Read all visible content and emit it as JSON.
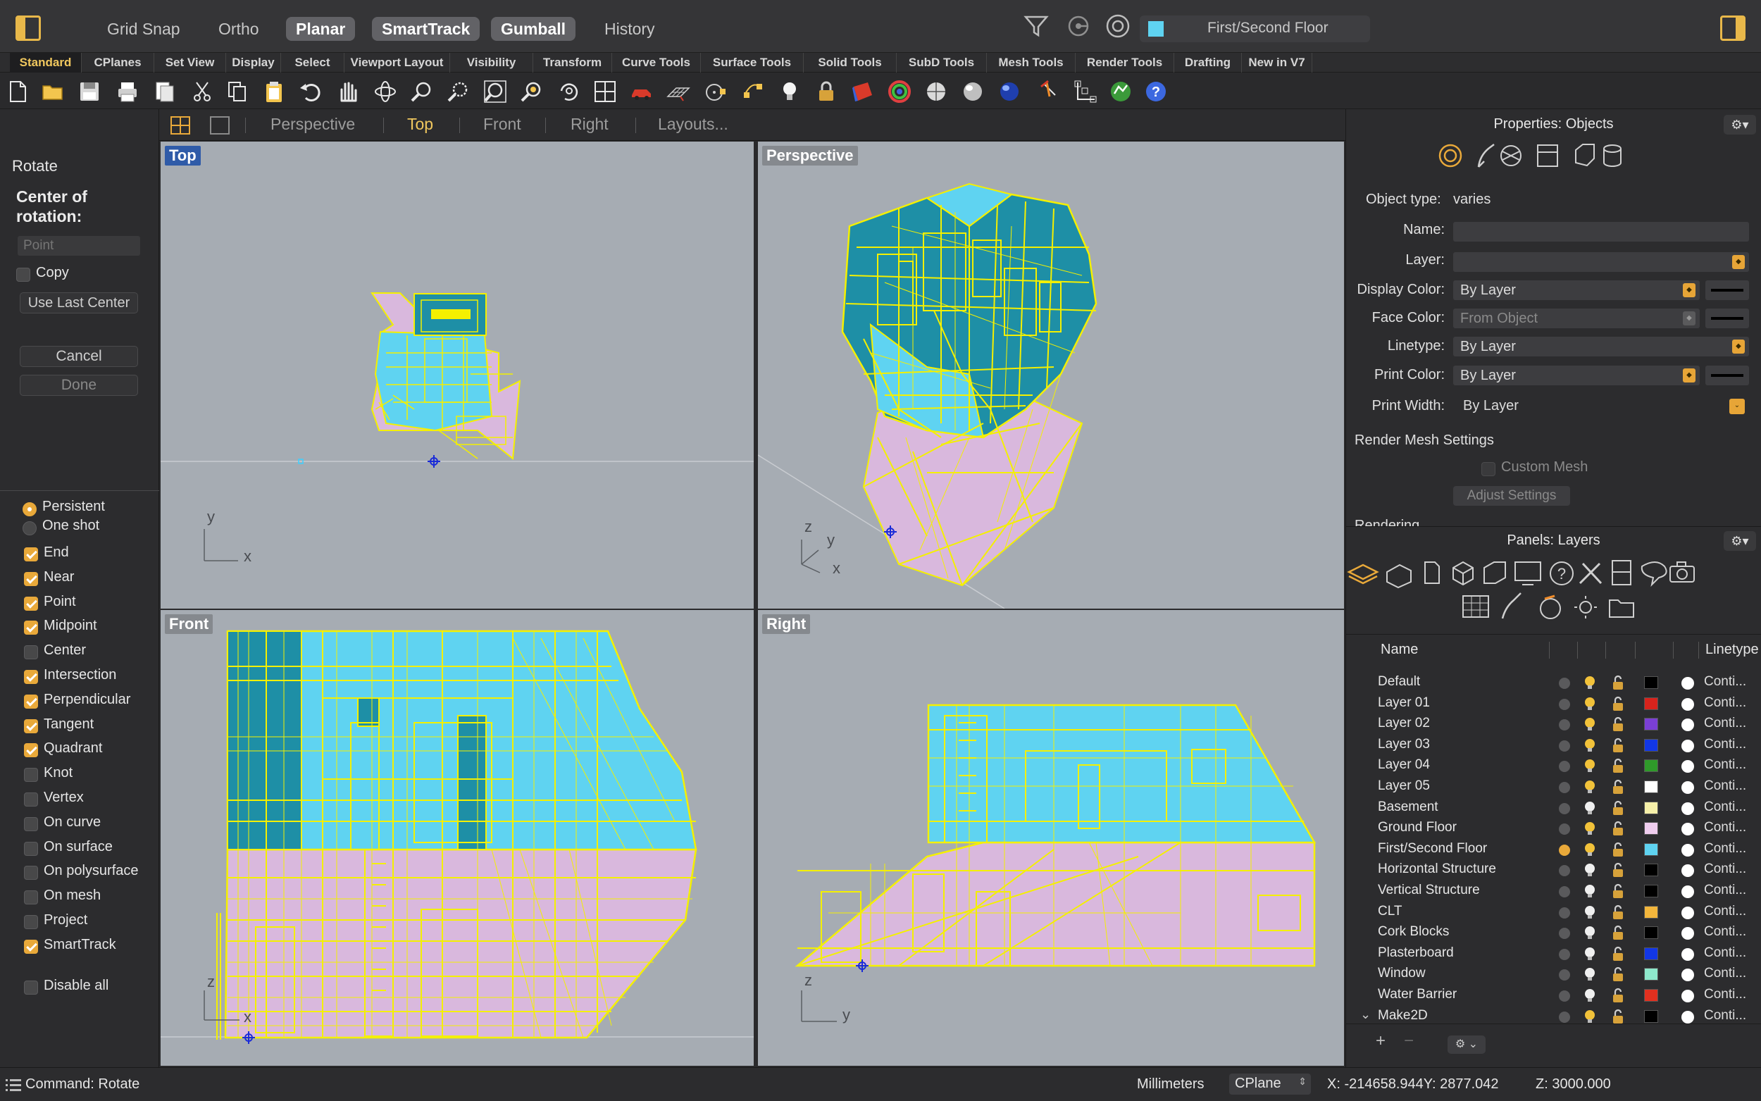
{
  "titlebar": {
    "modes": [
      {
        "label": "Grid Snap",
        "on": false
      },
      {
        "label": "Ortho",
        "on": false
      },
      {
        "label": "Planar",
        "on": true
      },
      {
        "label": "SmartTrack",
        "on": true
      },
      {
        "label": "Gumball",
        "on": true
      },
      {
        "label": "History",
        "on": false
      }
    ],
    "current_layer": "First/Second Floor",
    "current_layer_color": "#5fd3f1",
    "icons": [
      "sidebar-left-icon",
      "filter-icon",
      "record-history-icon",
      "osnap-icon",
      "sidebar-right-icon"
    ]
  },
  "tabs": [
    "Standard",
    "CPlanes",
    "Set View",
    "Display",
    "Select",
    "Viewport Layout",
    "Visibility",
    "Transform",
    "Curve Tools",
    "Surface Tools",
    "Solid Tools",
    "SubD Tools",
    "Mesh Tools",
    "Render Tools",
    "Drafting",
    "New in V7"
  ],
  "active_tab": "Standard",
  "viewport_tabs": {
    "items": [
      "Perspective",
      "Top",
      "Front",
      "Right",
      "Layouts..."
    ],
    "active": "Top"
  },
  "command_panel": {
    "title": "Rotate",
    "center_label": "Center of rotation:",
    "point_placeholder": "Point",
    "copy_label": "Copy",
    "use_last_center": "Use Last Center",
    "cancel": "Cancel",
    "done": "Done"
  },
  "osnap": {
    "modes": [
      {
        "label": "Persistent",
        "checked": true
      },
      {
        "label": "One shot",
        "checked": false
      }
    ],
    "items": [
      {
        "label": "End",
        "checked": true
      },
      {
        "label": "Near",
        "checked": true
      },
      {
        "label": "Point",
        "checked": true
      },
      {
        "label": "Midpoint",
        "checked": true
      },
      {
        "label": "Center",
        "checked": false
      },
      {
        "label": "Intersection",
        "checked": true
      },
      {
        "label": "Perpendicular",
        "checked": true
      },
      {
        "label": "Tangent",
        "checked": true
      },
      {
        "label": "Quadrant",
        "checked": true
      },
      {
        "label": "Knot",
        "checked": false
      },
      {
        "label": "Vertex",
        "checked": false
      },
      {
        "label": "On curve",
        "checked": false
      },
      {
        "label": "On surface",
        "checked": false
      },
      {
        "label": "On polysurface",
        "checked": false
      },
      {
        "label": "On mesh",
        "checked": false
      },
      {
        "label": "Project",
        "checked": false
      },
      {
        "label": "SmartTrack",
        "checked": true
      }
    ],
    "disable_all": "Disable all"
  },
  "viewports": {
    "top": {
      "label": "Top",
      "axis_a": "y",
      "axis_b": "x"
    },
    "perspective": {
      "label": "Perspective",
      "axis_a": "z",
      "axis_b": "y",
      "axis_c": "x"
    },
    "front": {
      "label": "Front",
      "axis_a": "z",
      "axis_b": "x"
    },
    "right": {
      "label": "Right",
      "axis_a": "z",
      "axis_b": "y"
    }
  },
  "properties": {
    "title": "Properties: Objects",
    "object_type_label": "Object type:",
    "object_type_value": "varies",
    "name_label": "Name:",
    "layer_label": "Layer:",
    "display_color_label": "Display Color:",
    "display_color_value": "By Layer",
    "face_color_label": "Face Color:",
    "face_color_value": "From Object",
    "linetype_label": "Linetype:",
    "linetype_value": "By Layer",
    "print_color_label": "Print Color:",
    "print_color_value": "By Layer",
    "print_width_label": "Print Width:",
    "print_width_value": "By Layer",
    "render_mesh_label": "Render Mesh Settings",
    "custom_mesh_label": "Custom Mesh",
    "adjust_settings": "Adjust Settings",
    "rendering_label": "Rendering"
  },
  "layers_panel": {
    "title": "Panels: Layers",
    "col_name": "Name",
    "col_linetype": "Linetype",
    "rows": [
      {
        "name": "Default",
        "color": "#000000",
        "linetype": "Conti...",
        "current": false,
        "light": "on"
      },
      {
        "name": "Layer 01",
        "color": "#d8231c",
        "linetype": "Conti...",
        "current": false,
        "light": "on"
      },
      {
        "name": "Layer 02",
        "color": "#7b3fd4",
        "linetype": "Conti...",
        "current": false,
        "light": "on"
      },
      {
        "name": "Layer 03",
        "color": "#1237e6",
        "linetype": "Conti...",
        "current": false,
        "light": "on"
      },
      {
        "name": "Layer 04",
        "color": "#2f9a2a",
        "linetype": "Conti...",
        "current": false,
        "light": "on"
      },
      {
        "name": "Layer 05",
        "color": "#ffffff",
        "linetype": "Conti...",
        "current": false,
        "light": "on"
      },
      {
        "name": "Basement",
        "color": "#f6f0a9",
        "linetype": "Conti...",
        "current": false,
        "light": "off"
      },
      {
        "name": "Ground Floor",
        "color": "#efcdee",
        "linetype": "Conti...",
        "current": false,
        "light": "on"
      },
      {
        "name": "First/Second Floor",
        "color": "#5fd3f1",
        "linetype": "Conti...",
        "current": true,
        "light": "on"
      },
      {
        "name": "Horizontal Structure",
        "color": "#000000",
        "linetype": "Conti...",
        "current": false,
        "light": "off"
      },
      {
        "name": "Vertical Structure",
        "color": "#000000",
        "linetype": "Conti...",
        "current": false,
        "light": "off"
      },
      {
        "name": "CLT",
        "color": "#f3b63c",
        "linetype": "Conti...",
        "current": false,
        "light": "off"
      },
      {
        "name": "Cork Blocks",
        "color": "#000000",
        "linetype": "Conti...",
        "current": false,
        "light": "off"
      },
      {
        "name": "Plasterboard",
        "color": "#1237e6",
        "linetype": "Conti...",
        "current": false,
        "light": "off"
      },
      {
        "name": "Window",
        "color": "#8ee8cb",
        "linetype": "Conti...",
        "current": false,
        "light": "off"
      },
      {
        "name": "Water Barrier",
        "color": "#e2301f",
        "linetype": "Conti...",
        "current": false,
        "light": "off"
      },
      {
        "name": "Make2D",
        "color": "#000000",
        "linetype": "Conti...",
        "current": false,
        "light": "on"
      }
    ]
  },
  "statusbar": {
    "command": "Command: Rotate",
    "units": "Millimeters",
    "cplane": "CPlane",
    "coords": "X: -214658.944Y: 2877.042",
    "z": "Z: 3000.000"
  },
  "colors": {
    "accent": "#e9a93a",
    "wire": "#f4f000",
    "upper_floor": "#5fd3f1",
    "ground_floor": "#d7b6dc",
    "viewport_bg": "#a6acb3"
  }
}
